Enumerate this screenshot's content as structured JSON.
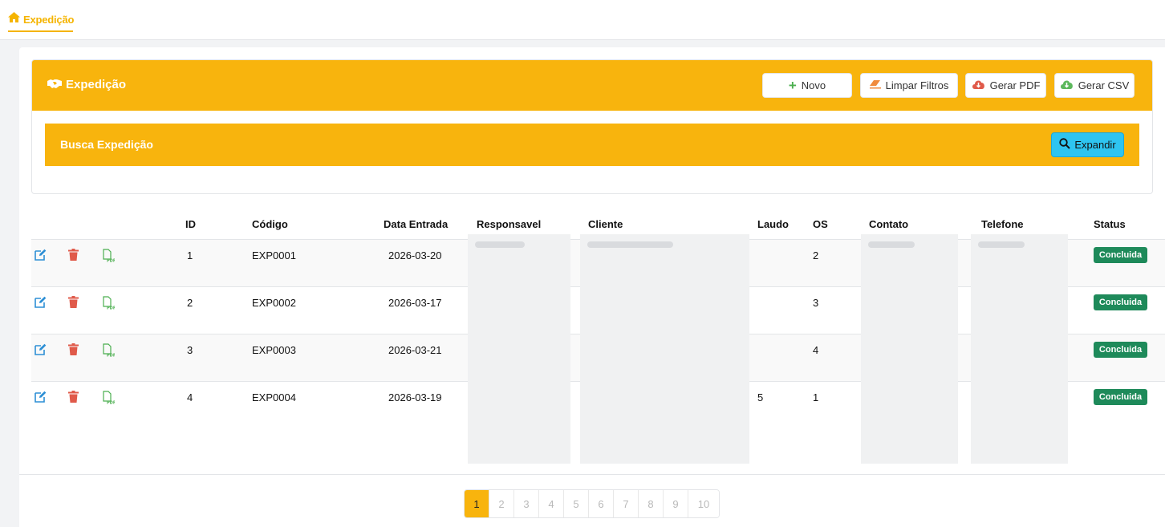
{
  "topbar": {
    "tab_label": "Expedição",
    "tab_icon": "home-icon",
    "accent": "#f5b400"
  },
  "card": {
    "title": "Expedição",
    "title_icon": "handshake-icon",
    "buttons": {
      "novo": "Novo",
      "limpar": "Limpar Filtros",
      "pdf": "Gerar PDF",
      "csv": "Gerar CSV"
    },
    "header_color": "#f8b40d"
  },
  "search": {
    "title": "Busca Expedição",
    "expand_label": "Expandir",
    "expand_color": "#2ec4f0"
  },
  "table": {
    "headers": {
      "id": "ID",
      "codigo": "Código",
      "data_entrada": "Data Entrada",
      "responsavel": "Responsavel",
      "cliente": "Cliente",
      "laudo": "Laudo",
      "os": "OS",
      "contato": "Contato",
      "telefone": "Telefone",
      "status": "Status"
    },
    "rows": [
      {
        "id": "1",
        "codigo": "EXP0001",
        "data": "2026-03-20",
        "laudo": "",
        "os": "2",
        "status": "Concluida"
      },
      {
        "id": "2",
        "codigo": "EXP0002",
        "data": "2026-03-17",
        "laudo": "",
        "os": "3",
        "status": "Concluida"
      },
      {
        "id": "3",
        "codigo": "EXP0003",
        "data": "2026-03-21",
        "laudo": "",
        "os": "4",
        "status": "Concluida"
      },
      {
        "id": "4",
        "codigo": "EXP0004",
        "data": "2026-03-19",
        "laudo": "5",
        "os": "1",
        "status": "Concluida"
      }
    ],
    "row_icons": [
      "edit-icon",
      "trash-icon",
      "pdf-file-icon"
    ],
    "status_color": "#1e8a5a"
  },
  "pagination": {
    "pages": [
      "1",
      "2",
      "3",
      "4",
      "5",
      "6",
      "7",
      "8",
      "9",
      "10"
    ],
    "current": "1"
  }
}
